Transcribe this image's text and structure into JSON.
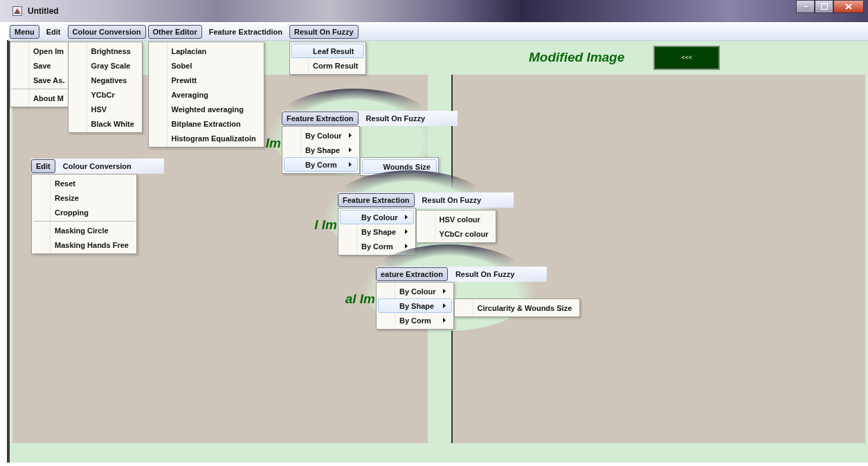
{
  "window": {
    "title": "Untitled"
  },
  "menubar": [
    {
      "label": "Menu",
      "selected": true,
      "items": [
        {
          "kind": "item",
          "label": "Open Im",
          "selected": false
        },
        {
          "kind": "item",
          "label": "Save",
          "selected": false
        },
        {
          "kind": "item",
          "label": "Save As.",
          "selected": false
        },
        {
          "kind": "separator"
        },
        {
          "kind": "item",
          "label": "About M",
          "selected": false
        }
      ]
    },
    {
      "label": "Edit",
      "selected": false
    },
    {
      "label": "Colour Conversion",
      "selected": true,
      "items": [
        {
          "label": "Brightness",
          "selected": false
        },
        {
          "label": "Gray Scale",
          "selected": false
        },
        {
          "label": "Negatives",
          "selected": false
        },
        {
          "label": "YCbCr",
          "selected": false
        },
        {
          "label": "HSV",
          "selected": false
        },
        {
          "label": "Black White",
          "selected": false
        }
      ]
    },
    {
      "label": "Other Editor",
      "selected": true,
      "items": [
        {
          "label": "Laplacian",
          "selected": false
        },
        {
          "label": "Sobel",
          "selected": false
        },
        {
          "label": "Prewitt",
          "selected": false
        },
        {
          "label": "Averaging",
          "selected": false
        },
        {
          "label": "Weighted averaging",
          "selected": false
        },
        {
          "label": "Bitplane Extraction",
          "selected": false
        },
        {
          "label": "Histogram Equalizatoin",
          "selected": false
        }
      ]
    },
    {
      "label": "Feature Extractidion",
      "selected": false
    },
    {
      "label": "Result On Fuzzy",
      "selected": true,
      "items": [
        {
          "label": "Leaf Result",
          "selected": true
        },
        {
          "label": "Corm Result",
          "selected": false
        }
      ]
    }
  ],
  "modified_label": "Modified Image",
  "back_button": "<<<",
  "insets": [
    {
      "menubar": [
        {
          "label": "Edit",
          "selected": true
        },
        {
          "label": "Colour Conversion",
          "selected": false
        }
      ],
      "items": [
        {
          "kind": "item",
          "label": "Reset",
          "selected": false
        },
        {
          "kind": "item",
          "label": "Resize",
          "selected": false
        },
        {
          "kind": "item",
          "label": "Cropping",
          "selected": false
        },
        {
          "kind": "separator"
        },
        {
          "kind": "item",
          "label": "Masking Circle",
          "selected": false
        },
        {
          "kind": "item",
          "label": "Masking Hands Free",
          "selected": false
        }
      ]
    },
    {
      "fragment": "Im",
      "menubar": [
        {
          "label": "Feature Extraction",
          "selected": true
        },
        {
          "label": "Result On Fuzzy",
          "selected": false
        }
      ],
      "items": [
        {
          "label": "By Colour",
          "selected": false,
          "submenu_arrow": true
        },
        {
          "label": "By Shape",
          "selected": false,
          "submenu_arrow": true
        },
        {
          "label": "By Corm",
          "selected": true,
          "submenu_arrow": true
        }
      ],
      "submenu": [
        {
          "label": "Wounds Size",
          "selected": true
        }
      ]
    },
    {
      "fragment": "l Im",
      "menubar": [
        {
          "label": "Feature Extraction",
          "selected": true
        },
        {
          "label": "Result On Fuzzy",
          "selected": false
        }
      ],
      "items": [
        {
          "label": "By Colour",
          "selected": true,
          "submenu_arrow": true
        },
        {
          "label": "By Shape",
          "selected": false,
          "submenu_arrow": true
        },
        {
          "label": "By Corm",
          "selected": false,
          "submenu_arrow": true
        }
      ],
      "submenu": [
        {
          "label": "HSV colour",
          "selected": false
        },
        {
          "label": "YCbCr colour",
          "selected": false
        }
      ]
    },
    {
      "fragment": "al Im",
      "menubar": [
        {
          "label": "eature Extraction",
          "selected": true
        },
        {
          "label": "Result On Fuzzy",
          "selected": false
        }
      ],
      "items": [
        {
          "label": "By Colour",
          "selected": false,
          "submenu_arrow": true
        },
        {
          "label": "By Shape",
          "selected": true,
          "submenu_arrow": true
        },
        {
          "label": "By Corm",
          "selected": false,
          "submenu_arrow": true
        }
      ],
      "submenu": [
        {
          "label": "Circularity & Wounds Size",
          "selected": false
        }
      ]
    }
  ]
}
